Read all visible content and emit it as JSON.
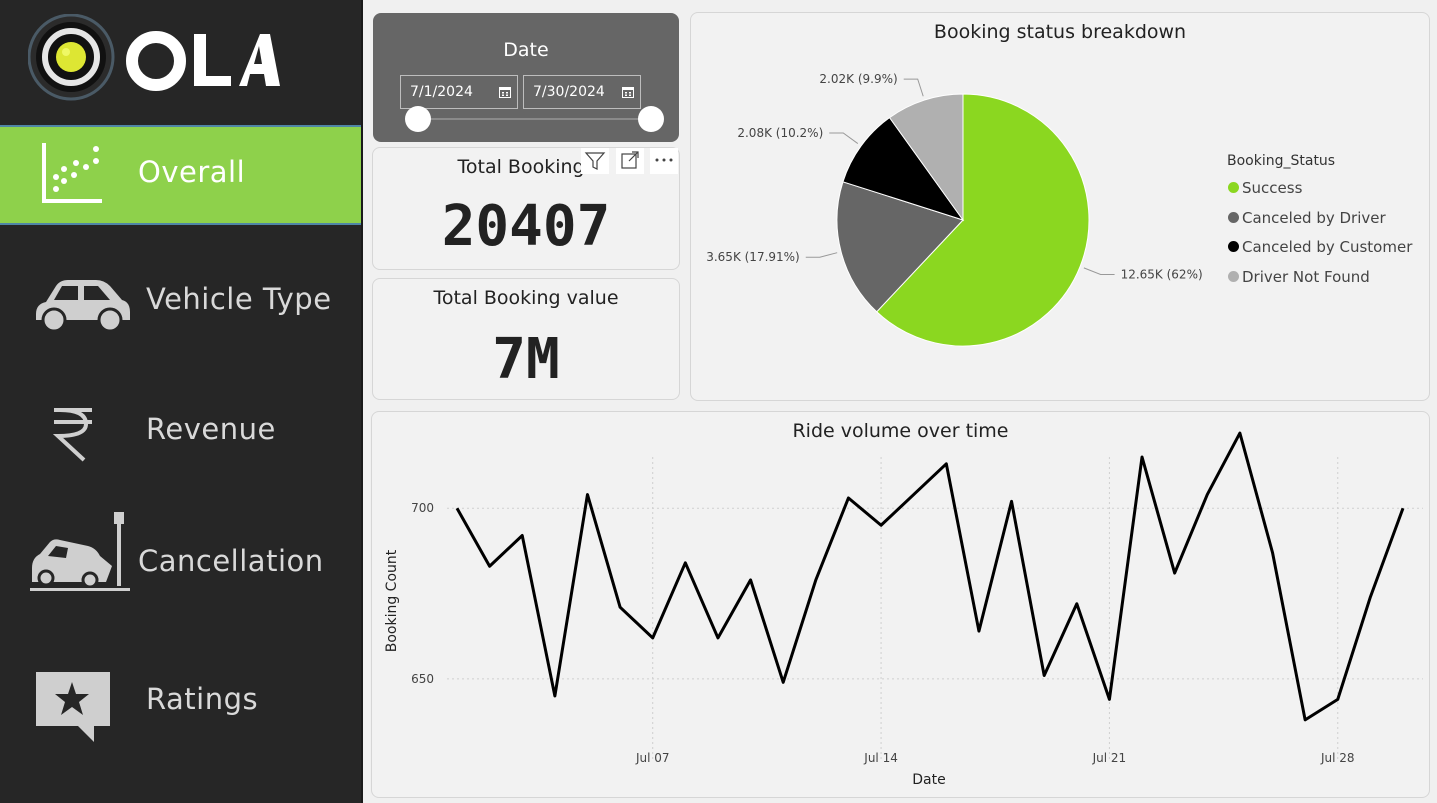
{
  "brand": {
    "name": "OLA"
  },
  "nav": {
    "items": [
      {
        "label": "Overall",
        "icon": "scatter-chart-icon",
        "active": true
      },
      {
        "label": "Vehicle Type",
        "icon": "car-icon",
        "active": false
      },
      {
        "label": "Revenue",
        "icon": "rupee-icon",
        "active": false
      },
      {
        "label": "Cancellation",
        "icon": "car-crash-icon",
        "active": false
      },
      {
        "label": "Ratings",
        "icon": "star-comment-icon",
        "active": false
      }
    ]
  },
  "date_filter": {
    "title": "Date",
    "start": "7/1/2024",
    "end": "7/30/2024"
  },
  "kpis": {
    "total_bookings": {
      "title": "Total Bookings",
      "value": "20407"
    },
    "total_value": {
      "title": "Total Booking value",
      "value": "7M"
    }
  },
  "colors": {
    "accent": "#8ed14b",
    "success": "#8bd720",
    "canceled_driver": "#666666",
    "canceled_customer": "#000000",
    "not_found": "#b0b0b0"
  },
  "pie": {
    "chart_data": {
      "type": "pie",
      "title": "Booking status breakdown",
      "legend_title": "Booking_Status",
      "legend_position": "right",
      "slices": [
        {
          "name": "Success",
          "value": 12650,
          "label": "12.65K (62%)",
          "percent": 62.0,
          "color": "#8bd720"
        },
        {
          "name": "Canceled by Driver",
          "value": 3650,
          "label": "3.65K (17.91%)",
          "percent": 17.91,
          "color": "#666666"
        },
        {
          "name": "Canceled by Customer",
          "value": 2080,
          "label": "2.08K (10.2%)",
          "percent": 10.2,
          "color": "#000000"
        },
        {
          "name": "Driver Not Found",
          "value": 2020,
          "label": "2.02K (9.9%)",
          "percent": 9.9,
          "color": "#b0b0b0"
        }
      ]
    }
  },
  "line": {
    "chart_data": {
      "type": "line",
      "title": "Ride volume over time",
      "xlabel": "Date",
      "ylabel": "Booking Count",
      "x_ticks": [
        "Jul 07",
        "Jul 14",
        "Jul 21",
        "Jul 28"
      ],
      "y_ticks": [
        650,
        700
      ],
      "ylim": [
        628,
        715
      ],
      "grid": true,
      "x": [
        "2024-07-01",
        "2024-07-02",
        "2024-07-03",
        "2024-07-04",
        "2024-07-05",
        "2024-07-06",
        "2024-07-07",
        "2024-07-08",
        "2024-07-09",
        "2024-07-10",
        "2024-07-11",
        "2024-07-12",
        "2024-07-13",
        "2024-07-14",
        "2024-07-15",
        "2024-07-16",
        "2024-07-17",
        "2024-07-18",
        "2024-07-19",
        "2024-07-20",
        "2024-07-21",
        "2024-07-22",
        "2024-07-23",
        "2024-07-24",
        "2024-07-25",
        "2024-07-26",
        "2024-07-27",
        "2024-07-28",
        "2024-07-29",
        "2024-07-30"
      ],
      "values": [
        700,
        683,
        692,
        645,
        704,
        671,
        662,
        684,
        662,
        679,
        649,
        679,
        703,
        695,
        704,
        713,
        664,
        702,
        651,
        672,
        644,
        715,
        681,
        704,
        722,
        687,
        638,
        644,
        674,
        700
      ]
    }
  }
}
